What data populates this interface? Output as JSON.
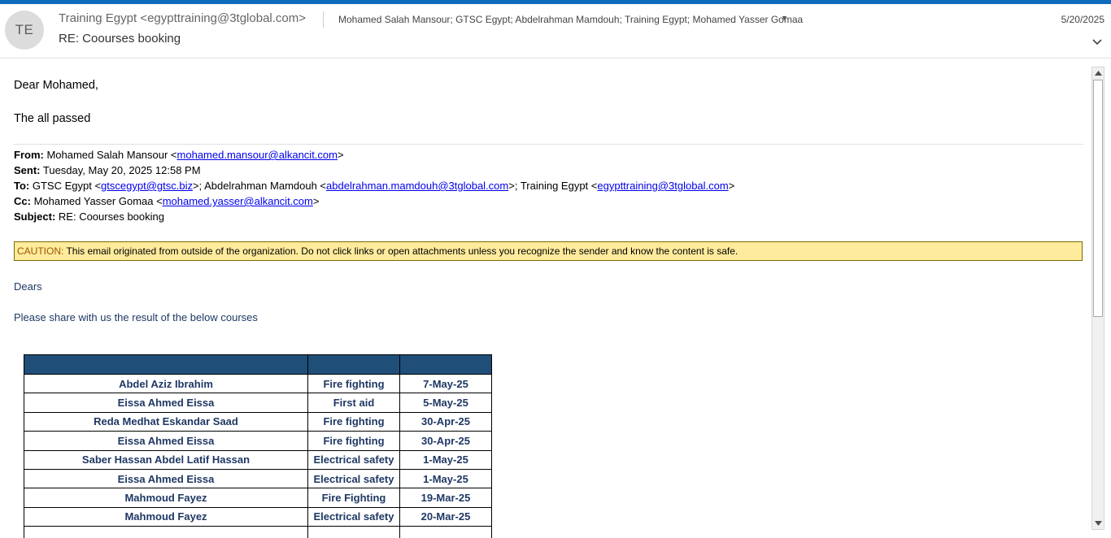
{
  "header": {
    "avatar_initials": "TE",
    "sender": "Training Egypt <egypttraining@3tglobal.com>",
    "recipients": "Mohamed Salah Mansour; GTSC Egypt; Abdelrahman Mamdouh; Training Egypt; Mohamed Yasser Gomaa",
    "date": "5/20/2025",
    "subject": "RE: Coourses booking",
    "icons": {
      "recipients_dropdown": "caret-down-icon",
      "expand": "chevron-down-icon"
    }
  },
  "body": {
    "greeting": "Dear Mohamed,",
    "message": "The all passed",
    "quoted": {
      "from_label": "From:",
      "from_name": " Mohamed Salah Mansour <",
      "from_email": "mohamed.mansour@alkancit.com",
      "from_end": ">",
      "sent_label": "Sent:",
      "sent_value": " Tuesday, May 20, 2025 12:58 PM",
      "to_label": "To:",
      "to_1": " GTSC Egypt <",
      "to_1_email": "gtscegypt@gtsc.biz",
      "to_2": ">; Abdelrahman Mamdouh <",
      "to_2_email": "abdelrahman.mamdouh@3tglobal.com",
      "to_3": ">; Training Egypt <",
      "to_3_email": "egypttraining@3tglobal.com",
      "to_end": ">",
      "cc_label": "Cc:",
      "cc_1": " Mohamed Yasser Gomaa <",
      "cc_email": "mohamed.yasser@alkancit.com",
      "cc_end": ">",
      "subject_label": "Subject:",
      "subject_value": " RE: Coourses booking"
    },
    "caution_label": "CAUTION:",
    "caution_text": " This email originated from outside of the organization. Do not click links or open attachments unless you recognize the sender and know the content is safe.",
    "dears": "Dears",
    "request": "Please share with us the result of the below courses",
    "table": {
      "rows": [
        [
          "Abdel Aziz Ibrahim",
          "Fire fighting",
          "7-May-25"
        ],
        [
          "Eissa Ahmed Eissa",
          "First aid",
          "5-May-25"
        ],
        [
          "Reda Medhat Eskandar Saad",
          "Fire fighting",
          "30-Apr-25"
        ],
        [
          "Eissa Ahmed Eissa",
          "Fire fighting",
          "30-Apr-25"
        ],
        [
          "Saber Hassan Abdel Latif Hassan",
          "Electrical safety",
          "1-May-25"
        ],
        [
          "Eissa Ahmed Eissa",
          "Electrical safety",
          "1-May-25"
        ],
        [
          "Mahmoud Fayez",
          "Fire Fighting",
          "19-Mar-25"
        ],
        [
          "Mahmoud Fayez",
          "Electrical safety",
          "20-Mar-25"
        ],
        [
          "",
          "",
          ""
        ]
      ]
    }
  },
  "colors": {
    "accent": "#0f6cbd",
    "table_header": "#1f4e79",
    "table_text": "#1f3864",
    "caution_bg": "#ffeb9c",
    "caution_label": "#9c5700",
    "link": "#0000ee"
  }
}
